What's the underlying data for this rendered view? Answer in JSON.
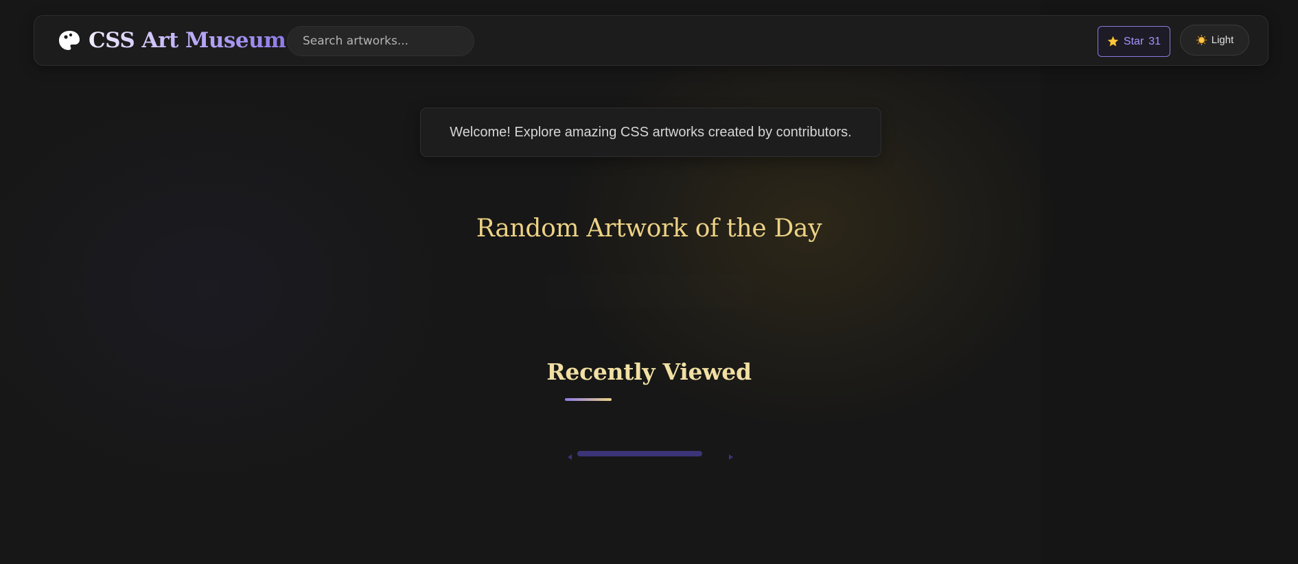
{
  "header": {
    "logo_icon": "palette-icon",
    "app_title": "CSS Art Museum",
    "search": {
      "placeholder": "Search artworks...",
      "value": ""
    },
    "star_button": {
      "icon": "star-icon",
      "label": "Star",
      "count": "31"
    },
    "theme_toggle": {
      "icon": "sun-icon",
      "label": "Light"
    }
  },
  "welcome": {
    "message": "Welcome! Explore amazing CSS artworks created by contributors."
  },
  "random_artwork": {
    "title": "Random Artwork of the Day"
  },
  "recently_viewed": {
    "title": "Recently Viewed",
    "scrollbar": {
      "left_arrow": "chevron-left-icon",
      "right_arrow": "chevron-right-icon"
    }
  },
  "colors": {
    "background": "#171717",
    "accent_purple": "#8f7be8",
    "accent_gold": "#ecd285",
    "star_text": "#a596ff",
    "scroll_track": "#3b3476"
  }
}
